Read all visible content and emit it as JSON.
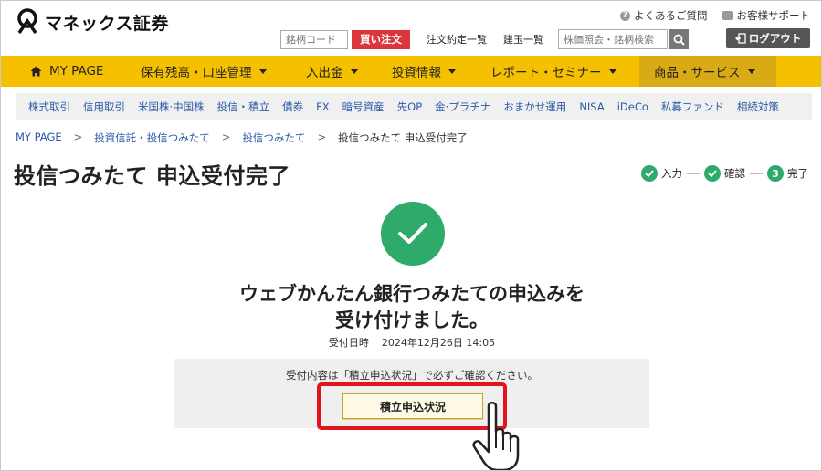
{
  "header": {
    "logo_text": "マネックス証券",
    "help_link": "よくあるご質問",
    "support_link": "お客様サポート",
    "code_input_placeholder": "銘柄コード",
    "buy_button": "買い注文",
    "order_list_link": "注文約定一覧",
    "position_list_link": "建玉一覧",
    "search_placeholder": "株価照会・銘柄検索",
    "logout_button": "ログアウト"
  },
  "main_nav": {
    "items": [
      {
        "label": "MY PAGE"
      },
      {
        "label": "保有残高・口座管理"
      },
      {
        "label": "入出金"
      },
      {
        "label": "投資情報"
      },
      {
        "label": "レポート・セミナー"
      },
      {
        "label": "商品・サービス"
      }
    ]
  },
  "sub_nav": {
    "items": [
      "株式取引",
      "信用取引",
      "米国株·中国株",
      "投信・積立",
      "債券",
      "FX",
      "暗号資産",
      "先OP",
      "金·プラチナ",
      "おまかせ運用",
      "NISA",
      "iDeCo",
      "私募ファンド",
      "相続対策"
    ]
  },
  "breadcrumb": {
    "items": [
      "MY PAGE",
      "投資信託・投信つみたて",
      "投信つみたて",
      "投信つみたて 申込受付完了"
    ]
  },
  "page": {
    "title": "投信つみたて 申込受付完了",
    "steps": [
      {
        "label": "入力",
        "state": "done"
      },
      {
        "label": "確認",
        "state": "done"
      },
      {
        "label": "完了",
        "number": "3",
        "state": "current"
      }
    ],
    "message_line1": "ウェブかんたん銀行つみたての申込みを",
    "message_line2": "受け付けました。",
    "date_label": "受付日時",
    "date_value": "2024年12月26日 14:05",
    "info_text": "受付内容は「積立申込状況」で必ずご確認ください。",
    "status_button": "積立申込状況"
  },
  "colors": {
    "brand_yellow": "#f5c000",
    "success_green": "#2eaa6a",
    "buy_red": "#d9363e",
    "highlight_red": "#e4141e",
    "link_blue": "#2a5aa7"
  }
}
